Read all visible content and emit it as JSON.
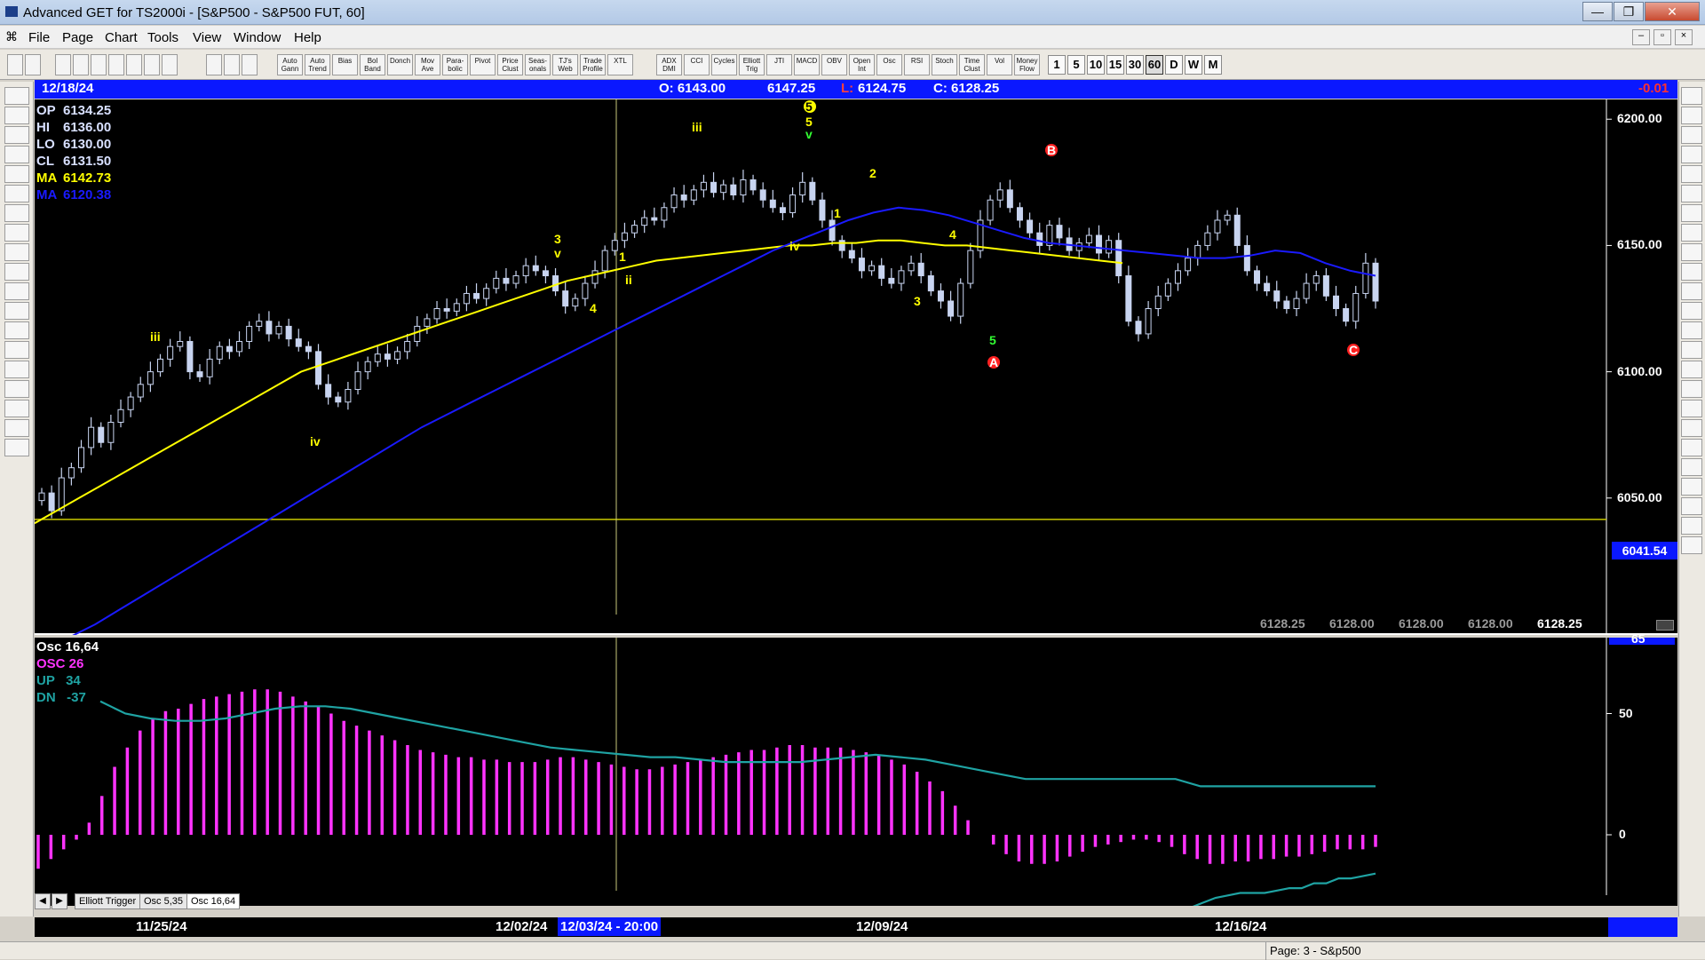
{
  "window": {
    "title": "Advanced GET for TS2000i - [S&P500 - S&P500 FUT, 60]",
    "minimize": "—",
    "maximize": "❐",
    "close": "✕"
  },
  "menu": {
    "items": [
      "File",
      "Page",
      "Chart",
      "Tools",
      "View",
      "Window",
      "Help"
    ]
  },
  "toolbar": {
    "study_buttons": [
      "Auto Gann",
      "Auto Trend",
      "Bias",
      "Bol Band",
      "Donch",
      "Mov Ave",
      "Para-bolic",
      "Pivot",
      "Price Clust",
      "Seas-onals",
      "TJ's Web",
      "Trade Profile",
      "XTL",
      "ADX DMI",
      "CCI",
      "Cycles",
      "Elliott Trig",
      "JTI",
      "MACD",
      "OBV",
      "Open Int",
      "Osc",
      "RSI",
      "Stoch",
      "Time Clust",
      "Vol",
      "Money Flow"
    ],
    "intervals": [
      "1",
      "5",
      "10",
      "15",
      "30",
      "60",
      "D",
      "W",
      "M"
    ],
    "selected_interval": "60"
  },
  "header": {
    "date": "12/18/24",
    "open": "O: 6143.00",
    "high": "6147.25",
    "low_label": "L:",
    "low": "6124.75",
    "close": "C: 6128.25",
    "change": "-0.01"
  },
  "price_panel": {
    "readouts": [
      {
        "label": "OP",
        "value": "6134.25",
        "color": "#d8e0ff"
      },
      {
        "label": "HI",
        "value": "6136.00",
        "color": "#d8e0ff"
      },
      {
        "label": "LO",
        "value": "6130.00",
        "color": "#d8e0ff"
      },
      {
        "label": "CL",
        "value": "6131.50",
        "color": "#d8e0ff"
      },
      {
        "label": "MA",
        "value": "6142.73",
        "color": "#ffff00"
      },
      {
        "label": "MA",
        "value": "6120.38",
        "color": "#1a1aff"
      }
    ],
    "y_ticks": [
      "6200.00",
      "6150.00",
      "6100.00",
      "6050.00"
    ],
    "current_price_tag": "6041.54",
    "bottom_values": [
      "6128.25",
      "6128.00",
      "6128.00",
      "6128.00",
      "6128.25"
    ]
  },
  "osc_panel": {
    "readouts": [
      {
        "text": "Osc 16,64",
        "color": "#ffffff"
      },
      {
        "text": "OSC 26",
        "color": "#ff33ff"
      },
      {
        "text": "UP   34",
        "color": "#1fa3a3"
      },
      {
        "text": "DN   -37",
        "color": "#1fa3a3"
      }
    ],
    "y_ticks": [
      "65",
      "50",
      "0"
    ],
    "tabs": [
      "Elliott Trigger",
      "Osc 5,35",
      "Osc 16,64"
    ]
  },
  "x_axis": {
    "labels": [
      "11/25/24",
      "12/02/24",
      "12/09/24",
      "12/16/24"
    ],
    "crosshair_label": "12/03/24 - 20:00"
  },
  "wave_labels": [
    {
      "text": "iii",
      "color": "#ffff00"
    },
    {
      "text": "iv",
      "color": "#ffff00"
    },
    {
      "text": "3",
      "color": "#ffff00"
    },
    {
      "text": "v",
      "color": "#ffff00"
    },
    {
      "text": "1",
      "color": "#ffff00"
    },
    {
      "text": "ii",
      "color": "#ffff00"
    },
    {
      "text": "4",
      "color": "#ffff00"
    },
    {
      "text": "iii",
      "color": "#ffff00"
    },
    {
      "text": "5",
      "color": "#ffff00"
    },
    {
      "text": "5",
      "color": "#ffff00"
    },
    {
      "text": "v",
      "color": "#33ff33"
    },
    {
      "text": "iv",
      "color": "#ffff00"
    },
    {
      "text": "1",
      "color": "#ffff00"
    },
    {
      "text": "2",
      "color": "#ffff00"
    },
    {
      "text": "3",
      "color": "#ffff00"
    },
    {
      "text": "4",
      "color": "#ffff00"
    },
    {
      "text": "5",
      "color": "#33ff33"
    },
    {
      "text": "A",
      "color": "#ff2020"
    },
    {
      "text": "B",
      "color": "#ff2020"
    },
    {
      "text": "C",
      "color": "#ff2020"
    }
  ],
  "status": {
    "page": "Page: 3 - S&p500"
  },
  "colors": {
    "candle": "#c8d4f0",
    "ma_fast": "#ffff00",
    "ma_slow": "#1a1aff",
    "osc": "#ff33ff",
    "band": "#1fa3a3",
    "header_bg": "#0a18ff"
  },
  "chart_data": {
    "type": "candlestick",
    "y_range": [
      6000,
      6205
    ],
    "closes": [
      6052,
      6045,
      6058,
      6062,
      6070,
      6078,
      6072,
      6080,
      6085,
      6090,
      6095,
      6100,
      6105,
      6110,
      6112,
      6100,
      6098,
      6105,
      6110,
      6108,
      6112,
      6118,
      6120,
      6115,
      6118,
      6113,
      6110,
      6108,
      6095,
      6090,
      6088,
      6093,
      6100,
      6104,
      6107,
      6105,
      6108,
      6112,
      6118,
      6121,
      6125,
      6124,
      6127,
      6131,
      6129,
      6133,
      6137,
      6135,
      6138,
      6142,
      6140,
      6138,
      6132,
      6126,
      6129,
      6135,
      6140,
      6148,
      6152,
      6155,
      6158,
      6161,
      6160,
      6165,
      6170,
      6168,
      6172,
      6175,
      6171,
      6174,
      6170,
      6176,
      6172,
      6168,
      6165,
      6163,
      6170,
      6175,
      6168,
      6160,
      6152,
      6148,
      6145,
      6140,
      6142,
      6137,
      6135,
      6140,
      6143,
      6138,
      6132,
      6128,
      6122,
      6135,
      6148,
      6160,
      6168,
      6172,
      6165,
      6160,
      6155,
      6150,
      6158,
      6153,
      6148,
      6151,
      6154,
      6147,
      6152,
      6138,
      6120,
      6115,
      6125,
      6130,
      6135,
      6140,
      6145,
      6150,
      6155,
      6160,
      6162,
      6150,
      6140,
      6135,
      6132,
      6128,
      6125,
      6129,
      6135,
      6138,
      6130,
      6125,
      6120,
      6131,
      6143,
      6128
    ],
    "ma_fast": [
      6040,
      6045,
      6050,
      6055,
      6060,
      6065,
      6070,
      6075,
      6080,
      6085,
      6090,
      6095,
      6100,
      6103,
      6106,
      6109,
      6112,
      6115,
      6118,
      6121,
      6124,
      6127,
      6130,
      6133,
      6136,
      6138,
      6140,
      6142,
      6144,
      6145,
      6146,
      6147,
      6148,
      6149,
      6150,
      6150,
      6151,
      6151,
      6152,
      6152,
      6151,
      6150,
      6150,
      6149,
      6148,
      6147,
      6146,
      6145,
      6144,
      6143
    ],
    "ma_slow": [
      5995,
      6000,
      6006,
      6012,
      6018,
      6024,
      6030,
      6036,
      6042,
      6048,
      6054,
      6060,
      6066,
      6072,
      6078,
      6083,
      6088,
      6093,
      6098,
      6103,
      6108,
      6113,
      6118,
      6123,
      6128,
      6133,
      6138,
      6143,
      6148,
      6152,
      6156,
      6160,
      6163,
      6165,
      6164,
      6162,
      6159,
      6156,
      6153,
      6151,
      6150,
      6149,
      6148,
      6147,
      6146,
      6145,
      6145,
      6146,
      6148,
      6147,
      6143,
      6140,
      6138
    ],
    "osc": [
      -14,
      -10,
      -6,
      -2,
      5,
      16,
      28,
      36,
      43,
      48,
      51,
      52,
      54,
      56,
      57,
      58,
      59,
      60,
      60,
      59,
      57,
      55,
      53,
      50,
      47,
      45,
      43,
      41,
      39,
      37,
      35,
      34,
      33,
      32,
      32,
      31,
      31,
      30,
      30,
      30,
      31,
      32,
      32,
      31,
      30,
      29,
      28,
      27,
      27,
      28,
      29,
      30,
      31,
      32,
      33,
      34,
      35,
      35,
      36,
      37,
      37,
      36,
      36,
      36,
      35,
      34,
      33,
      31,
      29,
      26,
      22,
      18,
      12,
      6,
      0,
      -4,
      -8,
      -11,
      -12,
      -12,
      -11,
      -9,
      -7,
      -5,
      -4,
      -3,
      -2,
      -2,
      -3,
      -5,
      -8,
      -10,
      -12,
      -12,
      -11,
      -11,
      -10,
      -10,
      -9,
      -9,
      -8,
      -7,
      -6,
      -6,
      -6,
      -5
    ],
    "band_up": [
      55,
      50,
      48,
      47,
      47,
      48,
      50,
      52,
      53,
      53,
      52,
      50,
      48,
      46,
      44,
      42,
      40,
      38,
      36,
      35,
      34,
      33,
      32,
      32,
      31,
      30,
      30,
      30,
      30,
      31,
      32,
      33,
      32,
      31,
      29,
      27,
      25,
      23,
      23,
      23,
      23,
      23,
      23,
      23,
      20,
      20,
      20,
      20,
      20,
      20,
      20,
      20
    ],
    "band_dn": [
      -37,
      -37,
      -36,
      -35,
      -34,
      -33,
      -31,
      -30,
      -28,
      -26,
      -25,
      -24,
      -24,
      -24,
      -23,
      -22,
      -22,
      -20,
      -20,
      -18,
      -18,
      -17,
      -16
    ],
    "y_ticks_osc": [
      65,
      50,
      0
    ]
  }
}
